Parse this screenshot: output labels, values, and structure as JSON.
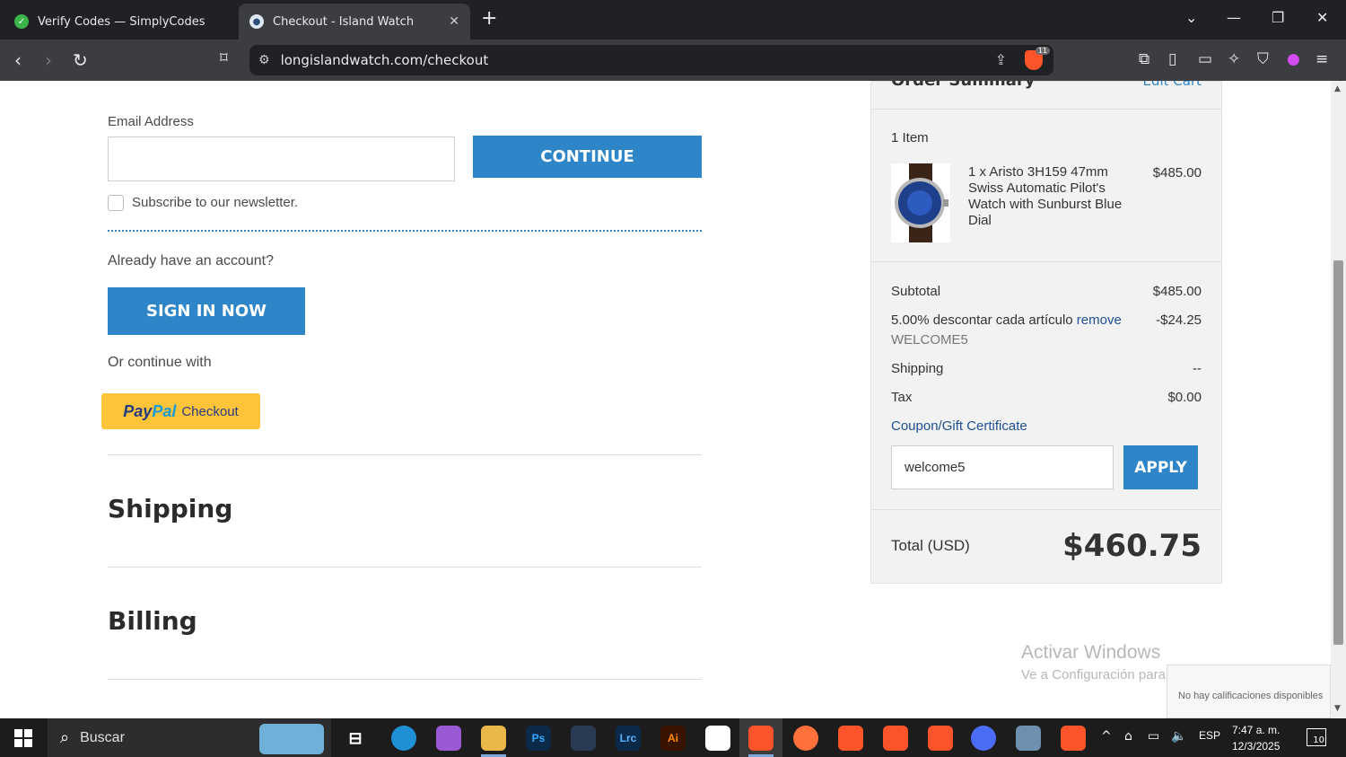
{
  "browser": {
    "tabs": [
      {
        "title": "Verify Codes — SimplyCodes",
        "active": false
      },
      {
        "title": "Checkout - Island Watch",
        "active": true
      }
    ],
    "url": "longislandwatch.com/checkout",
    "brave_badge": "11"
  },
  "checkout": {
    "email_label": "Email Address",
    "email_value": "",
    "continue_label": "CONTINUE",
    "newsletter_label": "Subscribe to our newsletter.",
    "account_question": "Already have an account?",
    "signin_label": "SIGN IN NOW",
    "or_continue": "Or continue with",
    "paypal": {
      "pay": "Pay",
      "pal": "Pal",
      "checkout": "Checkout"
    },
    "shipping_heading": "Shipping",
    "billing_heading": "Billing"
  },
  "summary": {
    "title": "Order Summary",
    "edit_cart": "Edit Cart",
    "item_count": "1 Item",
    "product_name": "1 x Aristo 3H159 47mm Swiss Automatic Pilot's Watch with Sunburst Blue Dial",
    "product_price": "$485.00",
    "subtotal_label": "Subtotal",
    "subtotal_value": "$485.00",
    "discount_label": "5.00% descontar cada artículo",
    "discount_remove": "remove",
    "discount_code": "WELCOME5",
    "discount_value": "-$24.25",
    "shipping_label": "Shipping",
    "shipping_value": "--",
    "tax_label": "Tax",
    "tax_value": "$0.00",
    "coupon_link": "Coupon/Gift Certificate",
    "coupon_value": "welcome5",
    "apply_label": "APPLY",
    "total_label": "Total (USD)",
    "total_value": "$460.75"
  },
  "watermark": {
    "line1": "Activar Windows",
    "line2": "Ve a Configuración para activar Windows.",
    "ratings": "No hay calificaciones disponibles"
  },
  "taskbar": {
    "search_label": "Buscar",
    "language": "ESP",
    "time": "7:47 a. m.",
    "date": "12/3/2025",
    "notifications": "10"
  }
}
